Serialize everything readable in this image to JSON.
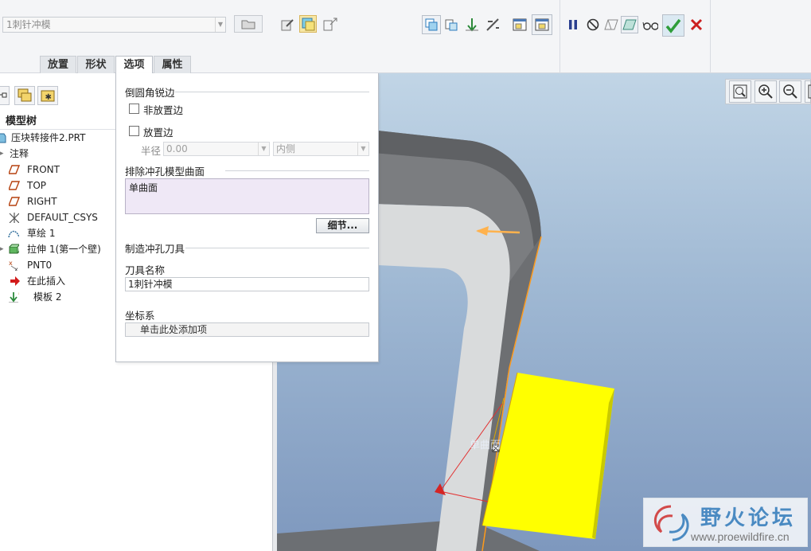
{
  "toolbar": {
    "tool_combo_value": "1刺针冲模"
  },
  "tabs": [
    "放置",
    "形状",
    "选项",
    "属性"
  ],
  "active_tab": "选项",
  "model_tree": {
    "title": "模型树",
    "items": [
      {
        "label": "压块转接件2.PRT",
        "icon": "part-icon"
      },
      {
        "label": "注释",
        "icon": "expand-arrow-icon"
      },
      {
        "label": "FRONT",
        "icon": "datum-plane-icon"
      },
      {
        "label": "TOP",
        "icon": "datum-plane-icon"
      },
      {
        "label": "RIGHT",
        "icon": "datum-plane-icon"
      },
      {
        "label": "DEFAULT_CSYS",
        "icon": "csys-icon"
      },
      {
        "label": "草绘 1",
        "icon": "sketch-icon"
      },
      {
        "label": "拉伸 1(第一个壁)",
        "icon": "extrude-wall-icon"
      },
      {
        "label": "PNT0",
        "icon": "datum-point-icon"
      },
      {
        "label": "在此插入",
        "icon": "insert-here-arrow-icon"
      },
      {
        "label": "模板 2",
        "icon": "form-feature-icon"
      }
    ]
  },
  "options_panel": {
    "section_round_sharp": "倒圆角锐边",
    "non_placement_edges": "非放置边",
    "placement_edges": "放置边",
    "radius_label": "半径",
    "radius_value": "0.00",
    "side_value": "内侧",
    "section_exclude": "排除冲孔模型曲面",
    "exclude_collector": "单曲面",
    "details_button": "细节...",
    "section_tool": "制造冲孔刀具",
    "tool_name_label": "刀具名称",
    "tool_name_value": "1刺针冲模",
    "csys_label": "坐标系",
    "csys_collector": "单击此处添加项"
  },
  "viewport": {
    "surface_label": "单曲面"
  },
  "watermark": {
    "title": "野火论坛",
    "url": "www.proewildfire.cn"
  },
  "colors": {
    "accent_check": "#2e9d3a",
    "cancel": "#cc1f1f",
    "yellow_tool": "#ffff00",
    "highlight_edge": "#ff9a1a"
  }
}
